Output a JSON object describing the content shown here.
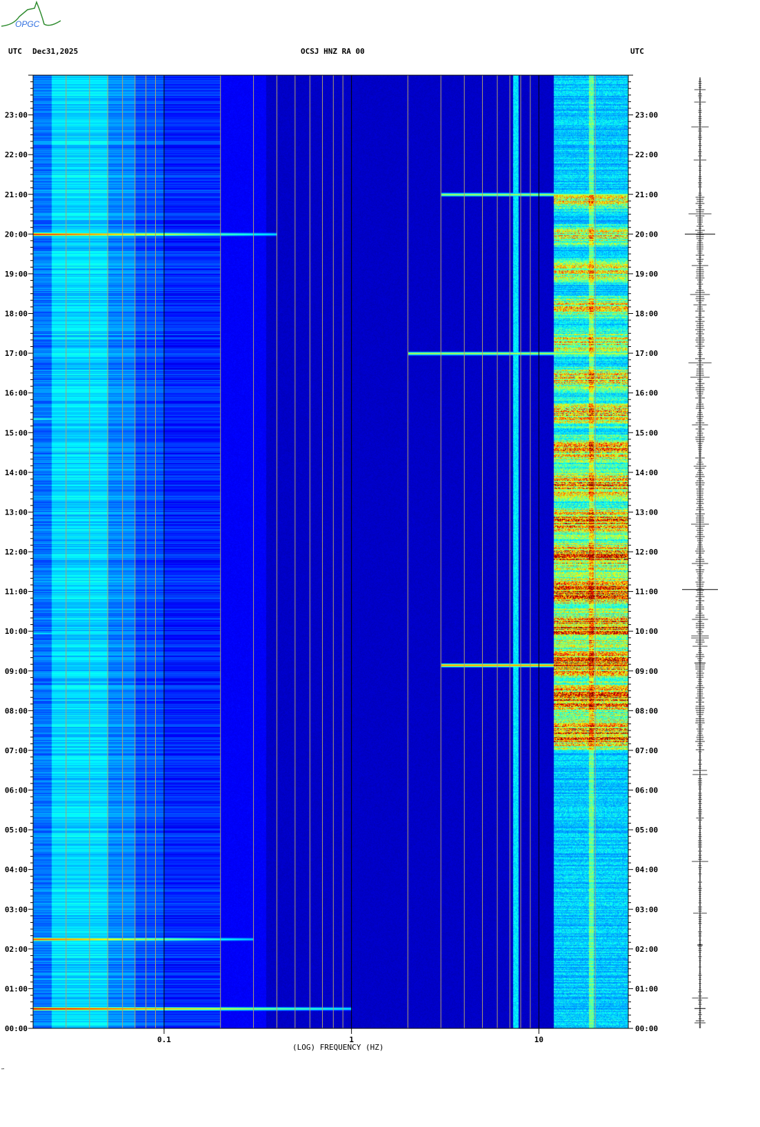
{
  "header": {
    "logo_text": "OPGC",
    "tz_left": "UTC",
    "date": "Dec31,2025",
    "station": "OCSJ HNZ RA 00",
    "tz_right": "UTC"
  },
  "footer_mark": "‴",
  "chart_data": {
    "type": "heatmap",
    "title": "OCSJ HNZ RA 00",
    "xlabel": "(LOG) FREQUENCY (HZ)",
    "ylabel": "UTC",
    "x_scale": "log",
    "xlim": [
      0.02,
      30
    ],
    "ylim_hours": [
      0,
      24
    ],
    "x_ticks": [
      {
        "value": 0.1,
        "label": "0.1"
      },
      {
        "value": 1,
        "label": "1"
      },
      {
        "value": 10,
        "label": "10"
      }
    ],
    "y_ticks": [
      "00:00",
      "01:00",
      "02:00",
      "03:00",
      "04:00",
      "05:00",
      "06:00",
      "07:00",
      "08:00",
      "09:00",
      "10:00",
      "11:00",
      "12:00",
      "13:00",
      "14:00",
      "15:00",
      "16:00",
      "17:00",
      "18:00",
      "19:00",
      "20:00",
      "21:00",
      "22:00",
      "23:00"
    ],
    "colormap": "jet",
    "grid_frequencies": [
      0.03,
      0.04,
      0.05,
      0.06,
      0.07,
      0.08,
      0.09,
      0.2,
      0.3,
      0.4,
      0.5,
      0.6,
      0.7,
      0.8,
      0.9,
      2,
      3,
      4,
      5,
      6,
      7,
      8,
      9,
      20,
      30
    ],
    "events": [
      {
        "hour": 0.5,
        "fmax": 1.0,
        "intensity": 1.0
      },
      {
        "hour": 2.25,
        "fmax": 0.3,
        "intensity": 0.9
      },
      {
        "hour": 15.35,
        "fmax": 0.09,
        "intensity": 0.45
      },
      {
        "hour": 20.0,
        "fmax": 0.4,
        "intensity": 0.95
      },
      {
        "hour": 9.95,
        "fmax": 0.1,
        "intensity": 0.4
      },
      {
        "hour": 9.15,
        "fmax": 30,
        "fmin": 3,
        "intensity": 0.8
      },
      {
        "hour": 17.0,
        "fmax": 30,
        "fmin": 2,
        "intensity": 0.6
      },
      {
        "hour": 21.0,
        "fmax": 30,
        "fmin": 3,
        "intensity": 0.6
      }
    ],
    "high_freq_activity": {
      "fmin": 12,
      "fmax": 30,
      "start_hour": 7,
      "end_hour": 21,
      "peak_hour": 9.2
    },
    "persistent_line_hz": 7.5
  }
}
